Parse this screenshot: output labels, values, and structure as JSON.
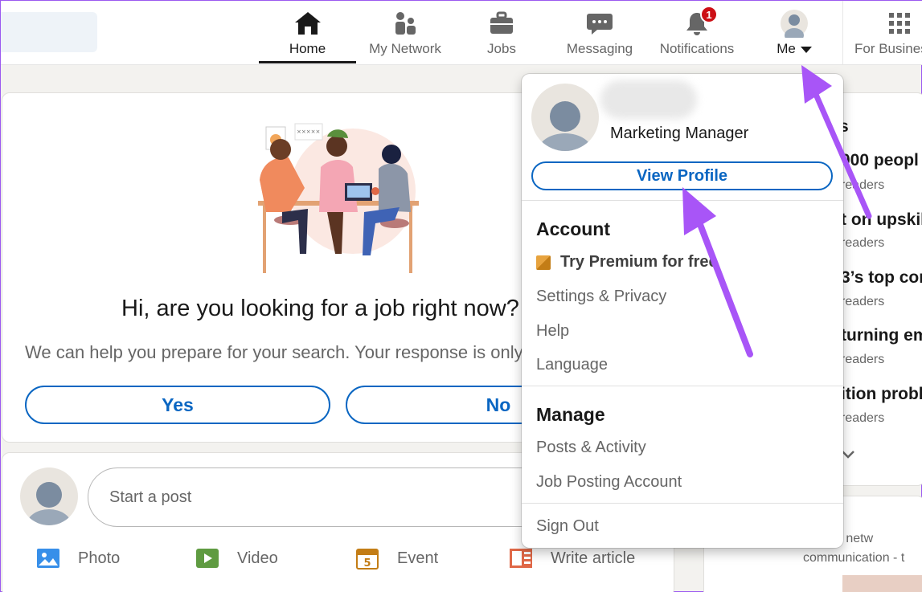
{
  "nav": {
    "items": [
      {
        "label": "Home",
        "icon": "home-icon"
      },
      {
        "label": "My Network",
        "icon": "network-icon"
      },
      {
        "label": "Jobs",
        "icon": "briefcase-icon"
      },
      {
        "label": "Messaging",
        "icon": "chat-icon"
      },
      {
        "label": "Notifications",
        "icon": "bell-icon",
        "badge": "1"
      },
      {
        "label": "Me",
        "icon": "avatar-icon"
      },
      {
        "label": "For Business",
        "icon": "grid-icon"
      }
    ]
  },
  "job_prompt": {
    "heading": "Hi, are you looking for a job right now?",
    "subtext": "We can help you prepare for your search. Your response is only visible to you.",
    "yes_label": "Yes",
    "no_label": "No"
  },
  "composer": {
    "placeholder": "Start a post",
    "actions": [
      {
        "label": "Photo",
        "icon": "photo-icon",
        "color": "#378fe9"
      },
      {
        "label": "Video",
        "icon": "video-icon",
        "color": "#5f9b41"
      },
      {
        "label": "Event",
        "icon": "calendar-icon",
        "color": "#c37d16",
        "icon_text": "5"
      },
      {
        "label": "Write article",
        "icon": "article-icon",
        "color": "#e06847"
      }
    ]
  },
  "news": {
    "heading": "s",
    "items": [
      {
        "title": "000 peopl",
        "meta": "readers"
      },
      {
        "title": "t on upskil",
        "meta": "readers"
      },
      {
        "title": "3’s top com",
        "meta": "readers"
      },
      {
        "title": "turning em",
        "meta": "readers"
      },
      {
        "title": "ition probl",
        "meta": "readers"
      }
    ]
  },
  "ad": {
    "line1": "ted AV, netw",
    "line2": "communication - t"
  },
  "me_menu": {
    "subtitle": "Marketing Manager",
    "view_profile": "View Profile",
    "account_heading": "Account",
    "account_items": [
      "Try Premium for free",
      "Settings & Privacy",
      "Help",
      "Language"
    ],
    "manage_heading": "Manage",
    "manage_items": [
      "Posts & Activity",
      "Job Posting Account"
    ],
    "sign_out": "Sign Out"
  },
  "colors": {
    "brand_blue": "#0a66c2",
    "annotation_purple": "#a855f7",
    "badge_red": "#cc1016"
  }
}
